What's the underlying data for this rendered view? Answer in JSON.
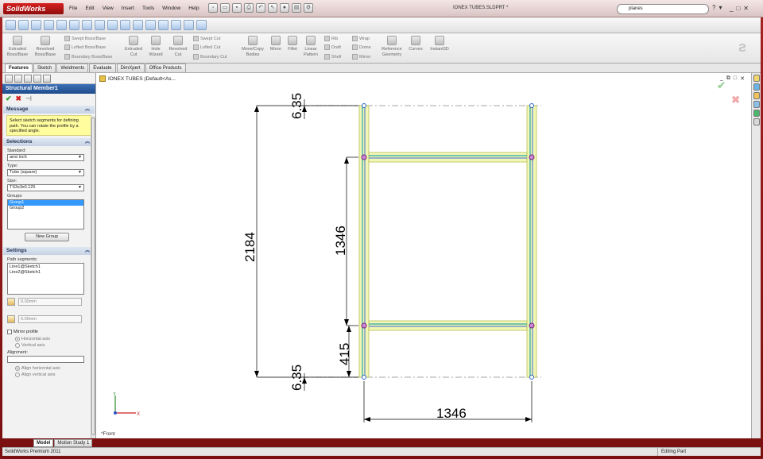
{
  "app": {
    "logo": "SolidWorks",
    "doc_title": "IONEX TUBES.SLDPRT *",
    "menu": [
      "File",
      "Edit",
      "View",
      "Insert",
      "Tools",
      "Window",
      "Help"
    ],
    "search_value": "planes",
    "win_controls": [
      "_",
      "□",
      "✕"
    ],
    "help": [
      "?",
      "▾"
    ]
  },
  "ribbon": {
    "large": [
      {
        "label": "Extruded\nBoss/Base"
      },
      {
        "label": "Revolved\nBoss/Base"
      },
      {
        "label": "Extruded\nCut"
      },
      {
        "label": "Hole\nWizard"
      },
      {
        "label": "Revolved\nCut"
      },
      {
        "label": "Move/Copy\nBodies"
      },
      {
        "label": "Mirror"
      },
      {
        "label": "Fillet"
      },
      {
        "label": "Linear\nPattern"
      },
      {
        "label": "Reference\nGeometry"
      },
      {
        "label": "Curves"
      },
      {
        "label": "Instant3D"
      }
    ],
    "small": [
      "Swept Boss/Base",
      "Lofted Boss/Base",
      "Boundary Boss/Base",
      "Swept Cut",
      "Lofted Cut",
      "Boundary Cut",
      "Rib",
      "Draft",
      "Shell",
      "Wrap",
      "Dome",
      "Mirror"
    ]
  },
  "tabs": [
    "Features",
    "Sketch",
    "Weldments",
    "Evaluate",
    "DimXpert",
    "Office Products"
  ],
  "tree_label": "IONEX TUBES  (Default<As...",
  "view_controls": [
    "_",
    "⧉",
    "□",
    "✕"
  ],
  "property_manager": {
    "title": "Structural Member1",
    "actions": {
      "ok": "✔",
      "cancel": "✖",
      "pin": "⊣"
    },
    "message_header": "Message",
    "message": "Select sketch segments for defining path. You can rotate the profile by a specified angle.",
    "selections_header": "Selections",
    "standard_label": "Standard:",
    "standard_value": "ansi inch",
    "type_label": "Type:",
    "type_value": "Tube (square)",
    "size_label": "Size:",
    "size_value": "TS3x3x0.125",
    "groups_label": "Groups:",
    "groups": [
      "Group1",
      "Group2"
    ],
    "new_group_button": "New Group",
    "settings_header": "Settings",
    "path_label": "Path segments:",
    "path_segments": [
      "Line1@Sketch1",
      "Line2@Sketch1"
    ],
    "angle1": "0.00mm",
    "angle2": "0.00mm",
    "mirror_label": "Mirror profile",
    "horizontal_axis": "Horizontal axis",
    "vertical_axis": "Vertical axis",
    "alignment_label": "Alignment:",
    "align_horizontal": "Align horizontal axis",
    "align_vertical": "Align vertical axis"
  },
  "dims": {
    "top_offset": "6.35",
    "height_total": "2184",
    "height_mid": "1346",
    "height_low": "415",
    "bottom_offset": "6.35",
    "width": "1346"
  },
  "view_name": "*Front",
  "bottom_tabs": [
    "Model",
    "Motion Study 1"
  ],
  "status": {
    "left": "SolidWorks Premium 2011",
    "right": "Editing Part"
  },
  "colors": {
    "frame": "#8b1a1a",
    "tube_fill": "#f2f7b5",
    "tube_center": "#5d84cc",
    "tube_inner": "#2aa6a6",
    "joint": "#7a1f7a"
  }
}
